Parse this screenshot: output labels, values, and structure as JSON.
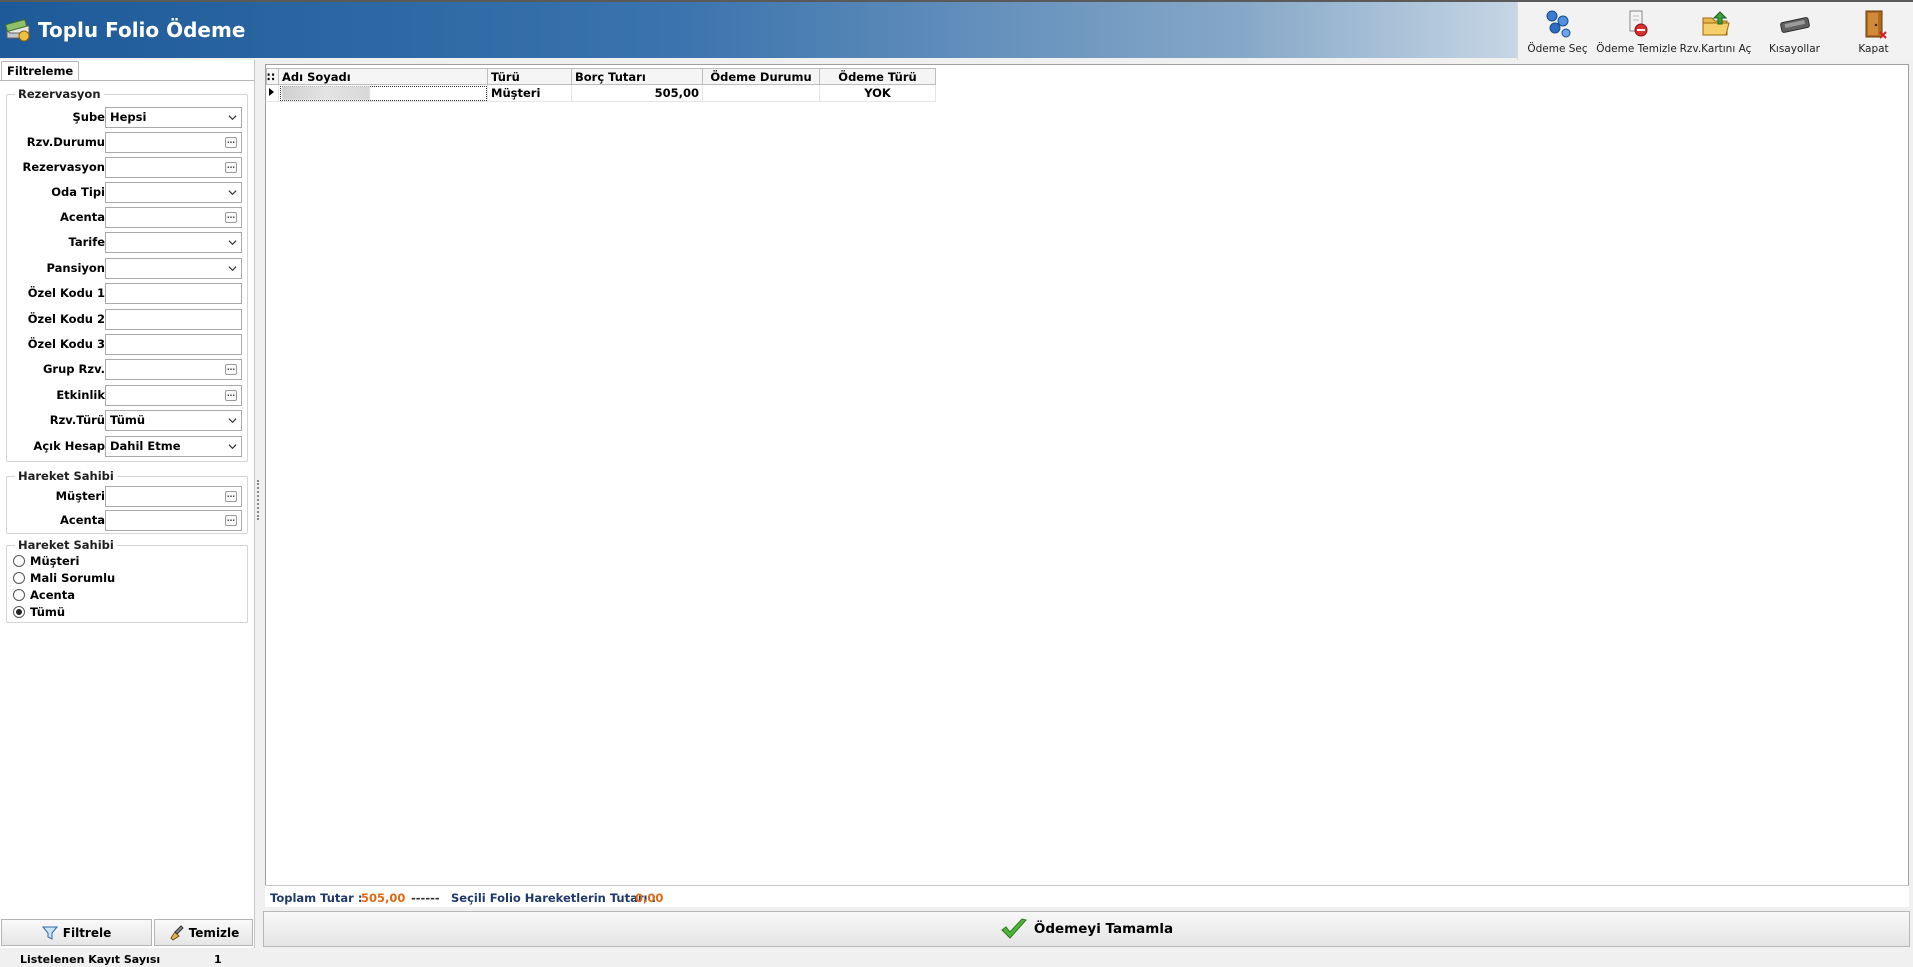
{
  "window": {
    "title": "Toplu Folio Ödeme"
  },
  "toolbar": {
    "odeme_sec": "Ödeme Seç",
    "odeme_temizle": "Ödeme Temizle",
    "rzv_karti_ac": "Rzv.Kartını Aç",
    "kisayollar": "Kısayollar",
    "kapat": "Kapat"
  },
  "filter": {
    "tab": "Filtreleme",
    "rezervasyon_group": "Rezervasyon",
    "fields": {
      "sube": {
        "label": "Şube",
        "value": "Hepsi"
      },
      "rzv_durumu": {
        "label": "Rzv.Durumu",
        "value": ""
      },
      "rezervasyon": {
        "label": "Rezervasyon",
        "value": ""
      },
      "oda_tipi": {
        "label": "Oda Tipi",
        "value": ""
      },
      "acenta": {
        "label": "Acenta",
        "value": ""
      },
      "tarife": {
        "label": "Tarife",
        "value": ""
      },
      "pansiyon": {
        "label": "Pansiyon",
        "value": ""
      },
      "ozel_kodu_1": {
        "label": "Özel Kodu 1",
        "value": ""
      },
      "ozel_kodu_2": {
        "label": "Özel Kodu 2",
        "value": ""
      },
      "ozel_kodu_3": {
        "label": "Özel Kodu 3",
        "value": ""
      },
      "grup_rzv": {
        "label": "Grup Rzv.",
        "value": ""
      },
      "etkinlik": {
        "label": "Etkinlik",
        "value": ""
      },
      "rzv_turu": {
        "label": "Rzv.Türü",
        "value": "Tümü"
      },
      "acik_hesap": {
        "label": "Açık Hesap",
        "value": "Dahil Etme"
      }
    },
    "hareket_sahibi_group": "Hareket Sahibi",
    "hs_fields": {
      "musteri": {
        "label": "Müşteri",
        "value": ""
      },
      "acenta": {
        "label": "Acenta",
        "value": ""
      }
    },
    "radio_group": "Hareket Sahibi",
    "radios": [
      "Müşteri",
      "Mali Sorumlu",
      "Acenta",
      "Tümü"
    ],
    "radio_selected": "Tümü",
    "btn_filtrele": "Filtrele",
    "btn_temizle": "Temizle"
  },
  "grid": {
    "columns": [
      "Adı Soyadı",
      "Türü",
      "Borç Tutarı",
      "Ödeme Durumu",
      "Ödeme Türü"
    ],
    "rows": [
      {
        "adi_soyadi": "",
        "turu": "Müşteri",
        "borc_tutari": "505,00",
        "odeme_durumu": "",
        "odeme_turu": "YOK"
      }
    ]
  },
  "summary": {
    "toplam_label": "Toplam Tutar :",
    "toplam_value": "505,00",
    "separator": "------",
    "secili_label": "Seçili Folio Hareketlerin Tutarı :",
    "secili_value": "0,00"
  },
  "complete_button": "Ödemeyi Tamamla",
  "status": {
    "label": "Listelenen Kayıt Sayısı",
    "value": "1"
  },
  "colors": {
    "header_blue": "#1e5a99",
    "orange_value": "#e06a12",
    "label_blue": "#1f3a6b"
  }
}
